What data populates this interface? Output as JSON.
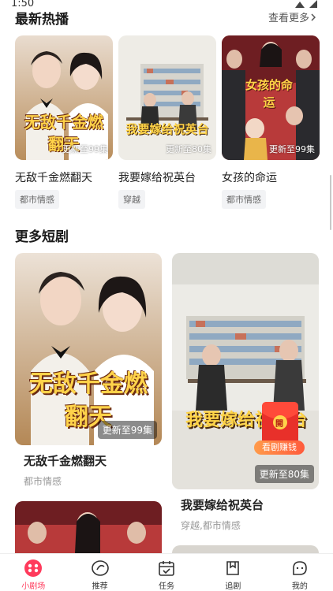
{
  "status": {
    "time": "1:50"
  },
  "hot": {
    "title": "最新热播",
    "see_more": "查看更多",
    "items": [
      {
        "title": "无敌千金燃翻天",
        "episode": "更新至99集",
        "tag": "都市情感",
        "poster_text": "无敌千金燃翻天"
      },
      {
        "title": "我要嫁给祝英台",
        "episode": "更新至80集",
        "tag": "穿越",
        "poster_text": "我要嫁给祝英台"
      },
      {
        "title": "女孩的命运",
        "episode": "更新至99集",
        "tag": "都市情感",
        "poster_text": "女孩的命运"
      }
    ]
  },
  "more": {
    "title": "更多短剧",
    "items": [
      {
        "title": "无敌千金燃翻天",
        "episode": "更新至99集",
        "tags": "都市情感",
        "poster_text": "无敌千金燃翻天"
      },
      {
        "title": "我要嫁给祝英台",
        "episode": "更新至80集",
        "tags": "穿越,都市情感",
        "poster_text": "我要嫁给祝英台"
      }
    ]
  },
  "red_packet": {
    "label": "看剧赚钱",
    "badge": "開"
  },
  "tabbar": {
    "items": [
      {
        "label": "小剧场",
        "icon": "theater-icon",
        "active": true
      },
      {
        "label": "推荐",
        "icon": "recommend-icon",
        "active": false
      },
      {
        "label": "任务",
        "icon": "calendar-task-icon",
        "active": false
      },
      {
        "label": "追剧",
        "icon": "bookmark-icon",
        "active": false
      },
      {
        "label": "我的",
        "icon": "profile-icon",
        "active": false
      }
    ]
  },
  "colors": {
    "accent": "#ff3b5c",
    "poster_warm": "#d9a75a",
    "poster_room": "#e8e6df",
    "poster_red": "#c23a3a"
  }
}
